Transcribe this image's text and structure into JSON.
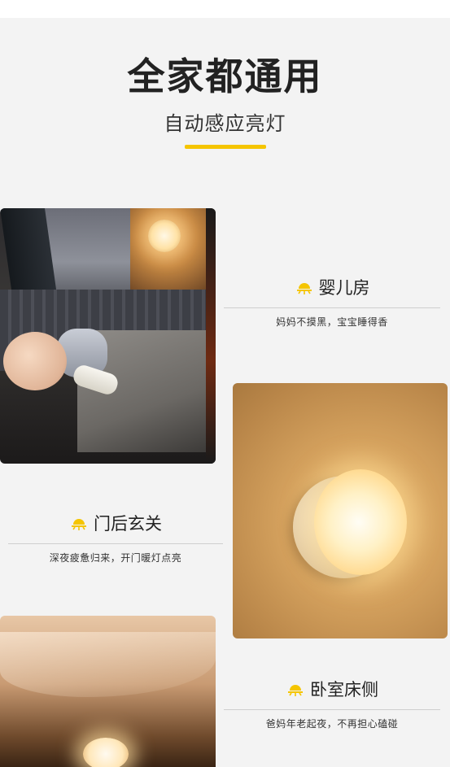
{
  "header": {
    "title": "全家都通用",
    "subtitle": "自动感应亮灯"
  },
  "sections": [
    {
      "title": "婴儿房",
      "desc": "妈妈不摸黑，宝宝睡得香"
    },
    {
      "title": "门后玄关",
      "desc": "深夜疲惫归来，开门暖灯点亮"
    },
    {
      "title": "卧室床侧",
      "desc": "爸妈年老起夜，不再担心磕碰"
    }
  ],
  "colors": {
    "accent": "#f5c500",
    "icon": "#f5c500"
  },
  "icons": {
    "section_icon": "lamp-glow-icon"
  }
}
